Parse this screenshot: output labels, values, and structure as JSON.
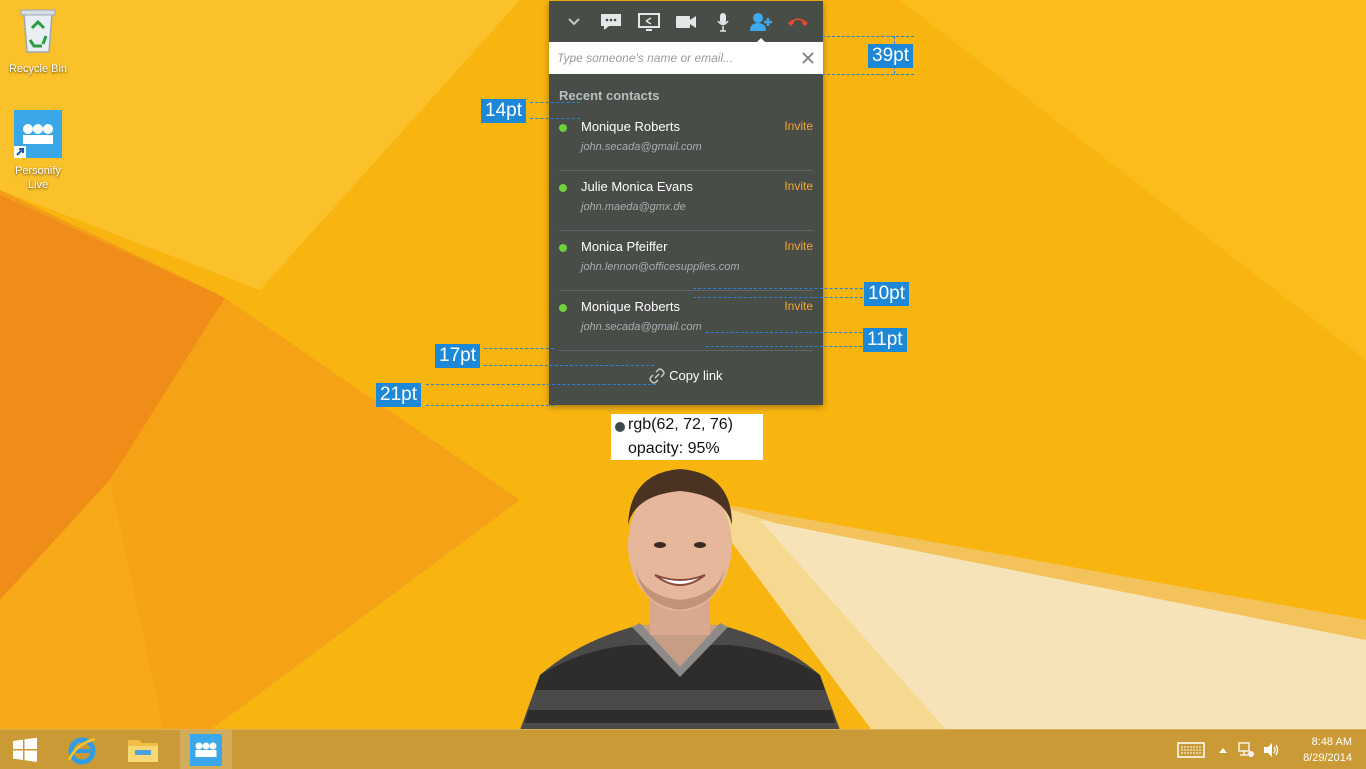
{
  "desktop": {
    "icons": [
      {
        "label": "Recycle Bin"
      },
      {
        "label": "Personify\nLive"
      }
    ]
  },
  "panel": {
    "bg_color": "#3e484c",
    "toolbar": [
      "collapse-icon",
      "chat-icon",
      "screen-share-icon",
      "video-icon",
      "microphone-icon",
      "add-person-icon",
      "hang-up-icon"
    ],
    "search": {
      "placeholder": "Type someone's name or email..."
    },
    "section_title": "Recent contacts",
    "contacts": [
      {
        "name": "Monique Roberts",
        "email": "john.secada@gmail.com",
        "action": "Invite"
      },
      {
        "name": "Julie Monica Evans",
        "email": "john.maeda@gmx.de",
        "action": "Invite"
      },
      {
        "name": "Monica Pfeiffer",
        "email": "john.lennon@officesupplies.com",
        "action": "Invite"
      },
      {
        "name": "Monique Roberts",
        "email": "john.secada@gmail.com",
        "action": "Invite"
      }
    ],
    "copy_link": "Copy link"
  },
  "annotations": {
    "b39": "39pt",
    "b14": "14pt",
    "b10": "10pt",
    "b11": "11pt",
    "b17": "17pt",
    "b21": "21pt"
  },
  "color_info": {
    "line1": "rgb(62, 72, 76)",
    "line2": "opacity: 95%"
  },
  "taskbar": {
    "time": "8:48 AM",
    "date": "8/29/2014"
  }
}
